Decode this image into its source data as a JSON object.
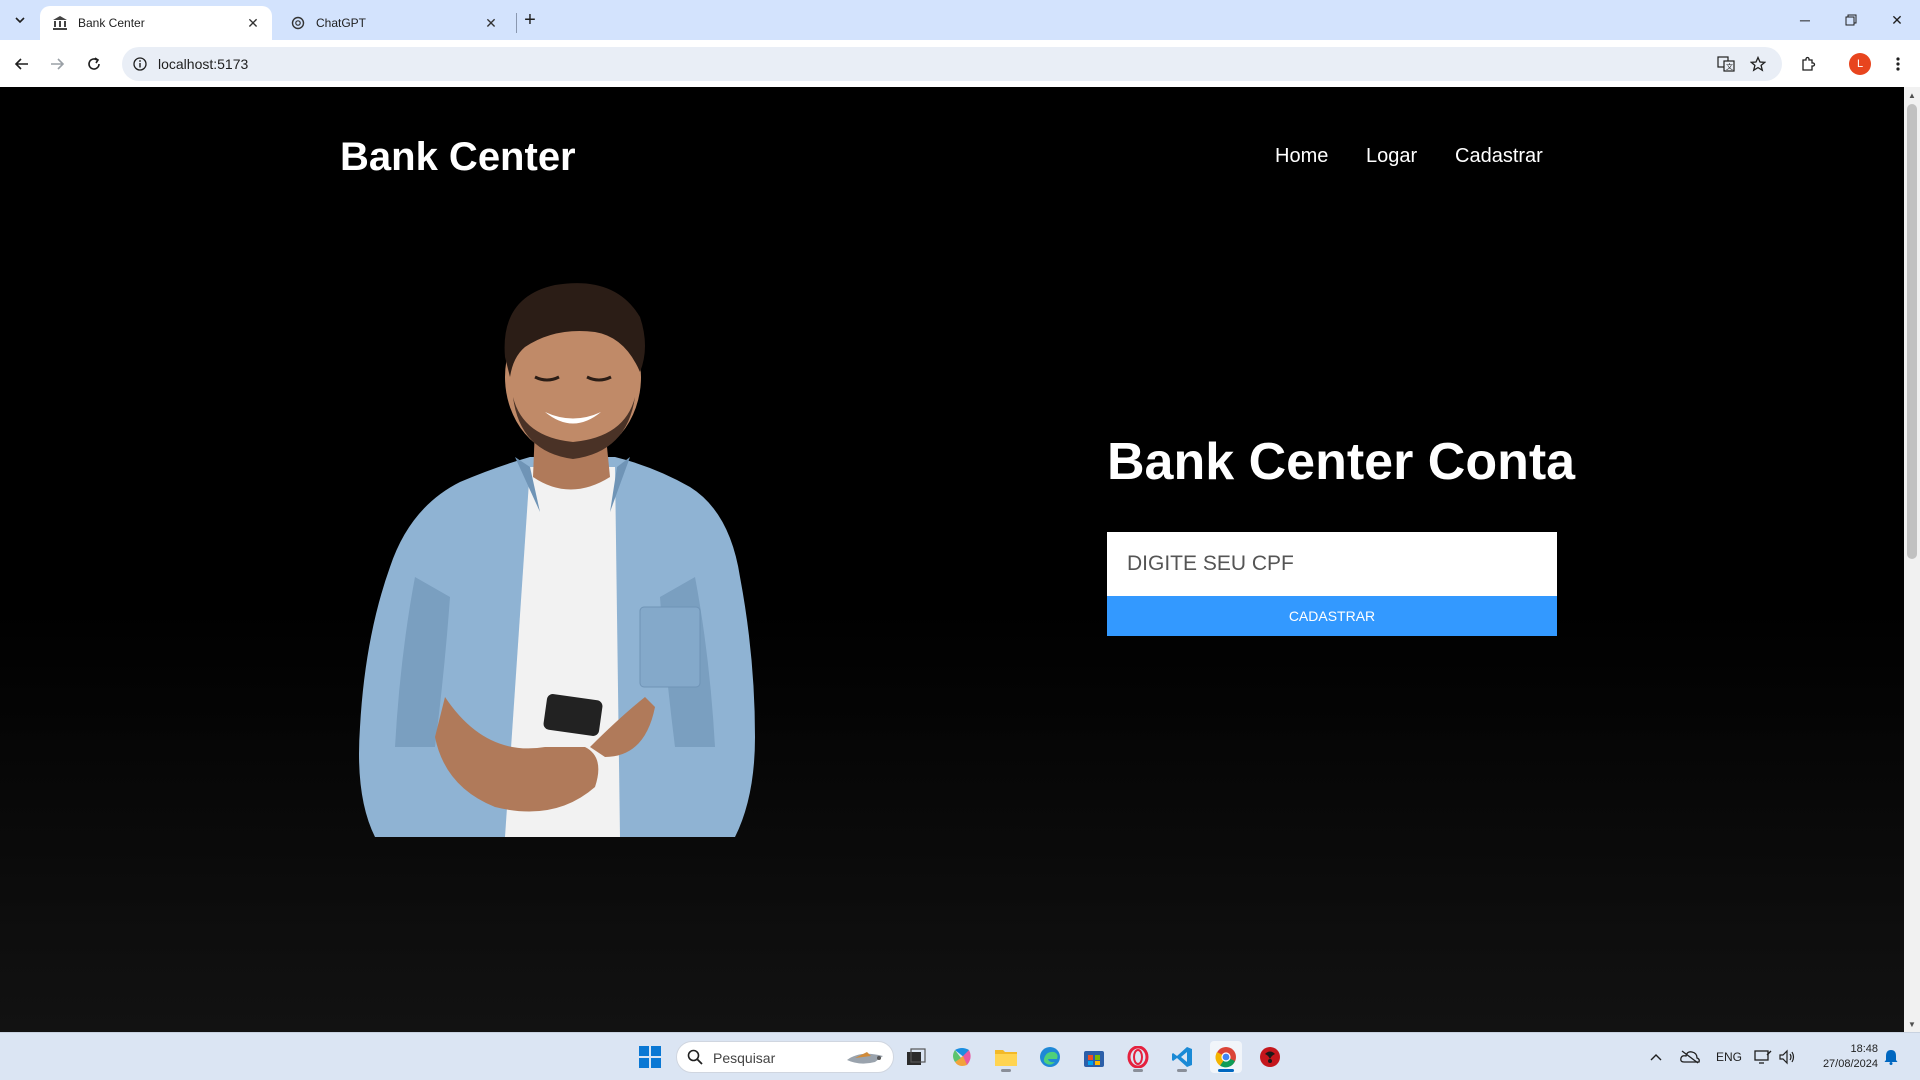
{
  "browser": {
    "tabs": [
      {
        "title": "Bank Center",
        "icon": "bank-icon",
        "active": true
      },
      {
        "title": "ChatGPT",
        "icon": "chatgpt-icon",
        "active": false
      }
    ],
    "url": "localhost:5173",
    "profile_initial": "L"
  },
  "site": {
    "brand": "Bank Center",
    "nav": [
      "Home",
      "Logar",
      "Cadastrar"
    ]
  },
  "form": {
    "title": "Bank Center Conta",
    "cpf_placeholder": "DIGITE SEU CPF",
    "submit_label": "CADASTRAR",
    "button_color": "#3399ff"
  },
  "taskbar": {
    "search_placeholder": "Pesquisar",
    "language": "ENG",
    "time": "18:48",
    "date": "27/08/2024"
  }
}
